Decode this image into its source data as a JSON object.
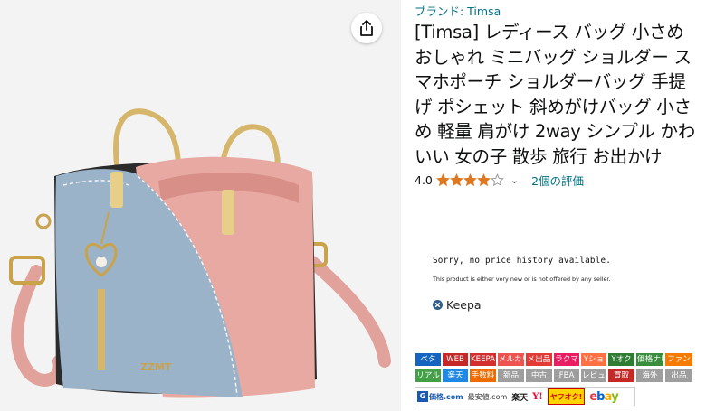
{
  "share": {
    "icon": "share-icon"
  },
  "product": {
    "brand_link": "ブランド: Timsa",
    "title": "[Timsa] レディース バッグ 小さめ おしゃれ ミニバッグ ショルダー スマホポーチ ショルダーバッグ 手提げ ポシェット 斜めがけバッグ 小さめ 軽量 肩がけ 2way シンプル かわいい 女の子 散歩 旅行 お出かけ",
    "rating_value": "4.0",
    "rating_stars": 4.0,
    "review_count": "2個の評価",
    "bag_logo_text": "ZZMT"
  },
  "keepa": {
    "no_history": "Sorry, no price history available.",
    "sub": "This product is either very new or is not offered by any seller.",
    "brand": "Keepa"
  },
  "badges_row1": [
    {
      "label": "ベタ",
      "color": "#1565c0"
    },
    {
      "label": "WEB",
      "color": "#c62828"
    },
    {
      "label": "KEEPA",
      "color": "#d32f2f"
    },
    {
      "label": "メルカリ",
      "color": "#ef5350"
    },
    {
      "label": "メ出品",
      "color": "#e53935"
    },
    {
      "label": "ラクマ",
      "color": "#e91e63"
    },
    {
      "label": "Yショ",
      "color": "#ff7043"
    },
    {
      "label": "Yオク",
      "color": "#2e7d32"
    },
    {
      "label": "価格ナビ",
      "color": "#388e3c"
    },
    {
      "label": "ファン",
      "color": "#f57c00"
    }
  ],
  "badges_row2": [
    {
      "label": "リアル",
      "color": "#43a047"
    },
    {
      "label": "楽天",
      "color": "#1e88e5"
    },
    {
      "label": "手数料",
      "color": "#ef6c00"
    },
    {
      "label": "新品",
      "color": "#9e9e9e"
    },
    {
      "label": "中古",
      "color": "#9e9e9e"
    },
    {
      "label": "FBA",
      "color": "#9e9e9e"
    },
    {
      "label": "レビュー",
      "color": "#9e9e9e"
    },
    {
      "label": "買取",
      "color": "#c62828"
    },
    {
      "label": "海外",
      "color": "#9e9e9e"
    },
    {
      "label": "出品",
      "color": "#9e9e9e"
    }
  ],
  "shops": {
    "kakaku_icon": "G",
    "kakaku": "価格.com",
    "saiyasu": "最安値.com",
    "rakuten": "楽天",
    "yahoo": "Y!",
    "yafuoku": "ヤフオク!",
    "ebay": "ebay"
  },
  "colors": {
    "link": "#007185",
    "star": "#de7921",
    "bag_pink": "#e8a9a3",
    "bag_blue": "#9bb3c8"
  }
}
